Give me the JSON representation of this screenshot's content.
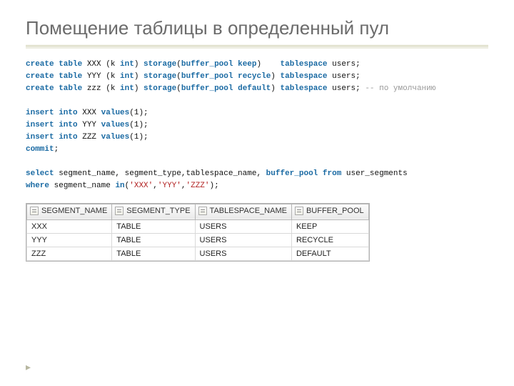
{
  "title": "Помещение таблицы в определенный пул",
  "code": {
    "l1": {
      "a": "create table",
      "b": " XXX (k ",
      "c": "int",
      "d": ") ",
      "e": "storage",
      "f": "(",
      "g": "buffer_pool keep",
      "h": ")    ",
      "i": "tablespace",
      "j": " users;"
    },
    "l2": {
      "a": "create table",
      "b": " YYY (k ",
      "c": "int",
      "d": ") ",
      "e": "storage",
      "f": "(",
      "g": "buffer_pool recycle",
      "h": ") ",
      "i": "tablespace",
      "j": " users;"
    },
    "l3": {
      "a": "create table",
      "b": " zzz (k ",
      "c": "int",
      "d": ") ",
      "e": "storage",
      "f": "(",
      "g": "buffer_pool default",
      "h": ") ",
      "i": "tablespace",
      "j": " users; ",
      "k": "-- по умолчанию"
    },
    "l5": {
      "a": "insert into",
      "b": " XXX ",
      "c": "values",
      "d": "(1);"
    },
    "l6": {
      "a": "insert into",
      "b": " YYY ",
      "c": "values",
      "d": "(1);"
    },
    "l7": {
      "a": "insert into",
      "b": " ZZZ ",
      "c": "values",
      "d": "(1);"
    },
    "l8": {
      "a": "commit",
      "b": ";"
    },
    "l10": {
      "a": "select",
      "b": " segment_name, segment_type,tablespace_name, ",
      "c": "buffer_pool from",
      "d": " user_segments"
    },
    "l11": {
      "a": "where",
      "b": " segment_name ",
      "c": "in",
      "d": "(",
      "e": "'XXX'",
      "f": ",",
      "g": "'YYY'",
      "h": ",",
      "i": "'ZZZ'",
      "j": ");"
    }
  },
  "table": {
    "headers": [
      "SEGMENT_NAME",
      "SEGMENT_TYPE",
      "TABLESPACE_NAME",
      "BUFFER_POOL"
    ],
    "rows": [
      {
        "c0": "XXX",
        "c1": "TABLE",
        "c2": "USERS",
        "c3": "KEEP"
      },
      {
        "c0": "YYY",
        "c1": "TABLE",
        "c2": "USERS",
        "c3": "RECYCLE"
      },
      {
        "c0": "ZZZ",
        "c1": "TABLE",
        "c2": "USERS",
        "c3": "DEFAULT"
      }
    ]
  },
  "footer_arrow": "▸"
}
